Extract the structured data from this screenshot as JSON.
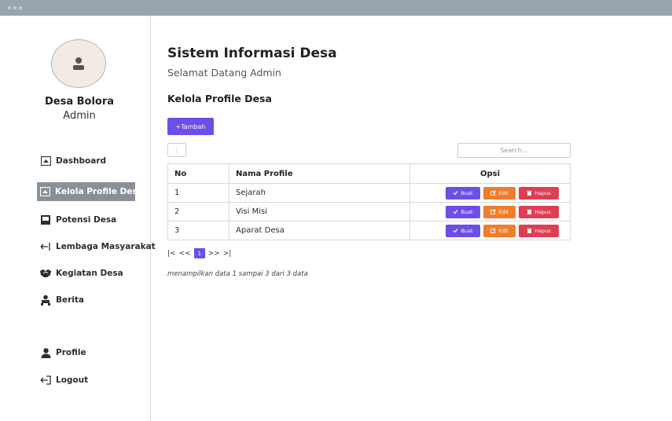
{
  "sidebar": {
    "name": "Desa Bolora",
    "role": "Admin",
    "items": [
      {
        "label": "Dashboard",
        "icon": "home-icon"
      },
      {
        "label": "Kelola Profile Desa",
        "icon": "home-icon"
      },
      {
        "label": "Potensi Desa",
        "icon": "square-icon"
      },
      {
        "label": "Lembaga Masyarakat",
        "icon": "arrow-left-icon"
      },
      {
        "label": "Kegiatan Desa",
        "icon": "handshake-icon"
      },
      {
        "label": "Berita",
        "icon": "users-icon"
      }
    ],
    "bottom_items": [
      {
        "label": "Profile",
        "icon": "user-icon"
      },
      {
        "label": "Logout",
        "icon": "logout-icon"
      }
    ],
    "active_index": 1
  },
  "main": {
    "title": "Sistem Informasi Desa",
    "welcome": "Selamat Datang  Admin",
    "section_title": "Kelola Profile Desa",
    "add_button": "+Tambah",
    "search_placeholder": "Search...",
    "table": {
      "headers": [
        "No",
        "Nama Profile",
        "Opsi"
      ],
      "rows": [
        {
          "no": "1",
          "nama": "Sejarah"
        },
        {
          "no": "2",
          "nama": "Visi Misi"
        },
        {
          "no": "3",
          "nama": "Aparat Desa"
        }
      ],
      "actions": {
        "buat": "Buat",
        "edit": "Edit",
        "hapus": "Hapus"
      }
    },
    "pagination": {
      "first": "|<",
      "prev": "<<",
      "current": "1",
      "next": ">>",
      "last": ">|"
    },
    "info": "menampilkan data 1 sampai 3 dari 3 data"
  },
  "colors": {
    "accent": "#6d4ee8",
    "edit": "#ef7d2c",
    "delete": "#df3e52",
    "active_nav": "#8a9097",
    "titlebar": "#9aa4ad"
  }
}
